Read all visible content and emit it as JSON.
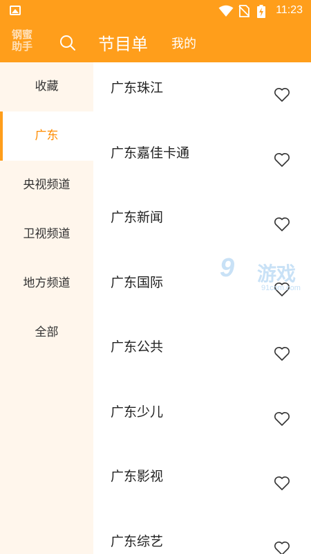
{
  "status_bar": {
    "time": "11:23",
    "icons": [
      "image-icon",
      "wifi-icon",
      "no-sim-icon",
      "battery-charging-icon"
    ]
  },
  "app_bar": {
    "logo_line1": "钢蜜",
    "logo_line2": "助手",
    "search_icon": "search-icon",
    "tabs": [
      {
        "label": "节目单",
        "active": true
      },
      {
        "label": "我的",
        "active": false
      }
    ]
  },
  "sidebar": {
    "items": [
      {
        "label": "收藏"
      },
      {
        "label": "广东",
        "active": true
      },
      {
        "label": "央视频道"
      },
      {
        "label": "卫视频道"
      },
      {
        "label": "地方频道"
      },
      {
        "label": "全部"
      }
    ]
  },
  "channels": [
    {
      "name": "广东珠江"
    },
    {
      "name": "广东嘉佳卡通"
    },
    {
      "name": "广东新闻"
    },
    {
      "name": "广东国际"
    },
    {
      "name": "广东公共"
    },
    {
      "name": "广东少儿"
    },
    {
      "name": "广东影视"
    },
    {
      "name": "广东综艺"
    }
  ],
  "watermark": {
    "big": "9",
    "cn": "游戏",
    "url": "91com.com"
  },
  "colors": {
    "accent": "#ff9e1b",
    "active_text": "#ff8c00",
    "sidebar_bg": "#fff6ec"
  }
}
